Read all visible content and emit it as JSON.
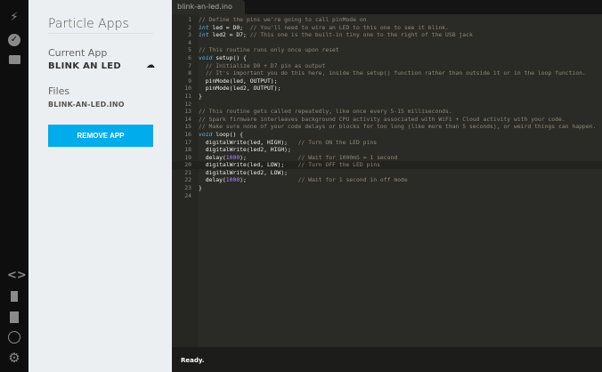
{
  "iconbar": {
    "top": [
      "flash-icon",
      "check-circle-icon",
      "folder-icon"
    ],
    "bottom": [
      "code-icon",
      "bookmark-icon",
      "document-icon",
      "target-icon",
      "gear-icon"
    ]
  },
  "sidebar": {
    "title": "Particle Apps",
    "current_app_label": "Current App",
    "current_app": "BLINK AN LED",
    "files_label": "Files",
    "file": "BLINK-AN-LED.INO",
    "remove_button": "REMOVE APP"
  },
  "editor": {
    "tab": "blink-an-led.ino",
    "status": "Ready.",
    "current_line": 20,
    "lines": [
      [
        [
          "cm",
          "// Define the pins we're going to call pinMode on"
        ]
      ],
      [
        [
          "kw",
          "int"
        ],
        [
          "id",
          " led = D0;  "
        ],
        [
          "cm",
          "// You'll need to wire an LED to this one to see it blink."
        ]
      ],
      [
        [
          "kw",
          "int"
        ],
        [
          "id",
          " led2 = D7; "
        ],
        [
          "cm",
          "// This one is the built-in tiny one to the right of the USB jack"
        ]
      ],
      [],
      [
        [
          "cm",
          "// This routine runs only once upon reset"
        ]
      ],
      [
        [
          "kw",
          "void"
        ],
        [
          "id",
          " setup() {"
        ]
      ],
      [
        [
          "cm",
          "  // Initialize D0 + D7 pin as output"
        ]
      ],
      [
        [
          "cm",
          "  // It's important you do this here, inside the setup() function rather than outside it or in the loop function."
        ]
      ],
      [
        [
          "id",
          "  pinMode(led, OUTPUT);"
        ]
      ],
      [
        [
          "id",
          "  pinMode(led2, OUTPUT);"
        ]
      ],
      [
        [
          "id",
          "}"
        ]
      ],
      [],
      [
        [
          "cm",
          "// This routine gets called repeatedly, like once every 5-15 milliseconds."
        ]
      ],
      [
        [
          "cm",
          "// Spark firmware interleaves background CPU activity associated with WiFi + Cloud activity with your code."
        ]
      ],
      [
        [
          "cm",
          "// Make sure none of your code delays or blocks for too long (like more than 5 seconds), or weird things can happen."
        ]
      ],
      [
        [
          "kw",
          "void"
        ],
        [
          "id",
          " loop() {"
        ]
      ],
      [
        [
          "id",
          "  digitalWrite(led, HIGH);   "
        ],
        [
          "cm",
          "// Turn ON the LED pins"
        ]
      ],
      [
        [
          "id",
          "  digitalWrite(led2, HIGH);"
        ]
      ],
      [
        [
          "id",
          "  delay("
        ],
        [
          "nm",
          "1000"
        ],
        [
          "id",
          ");               "
        ],
        [
          "cm",
          "// Wait for 1000mS = 1 second"
        ]
      ],
      [
        [
          "id",
          "  digitalWrite(led, LOW);    "
        ],
        [
          "cm",
          "// Turn OFF the LED pins"
        ]
      ],
      [
        [
          "id",
          "  digitalWrite(led2, LOW);"
        ]
      ],
      [
        [
          "id",
          "  delay("
        ],
        [
          "nm",
          "1000"
        ],
        [
          "id",
          ");               "
        ],
        [
          "cm",
          "// Wait for 1 second in off mode"
        ]
      ],
      [
        [
          "id",
          "}"
        ]
      ],
      []
    ]
  }
}
